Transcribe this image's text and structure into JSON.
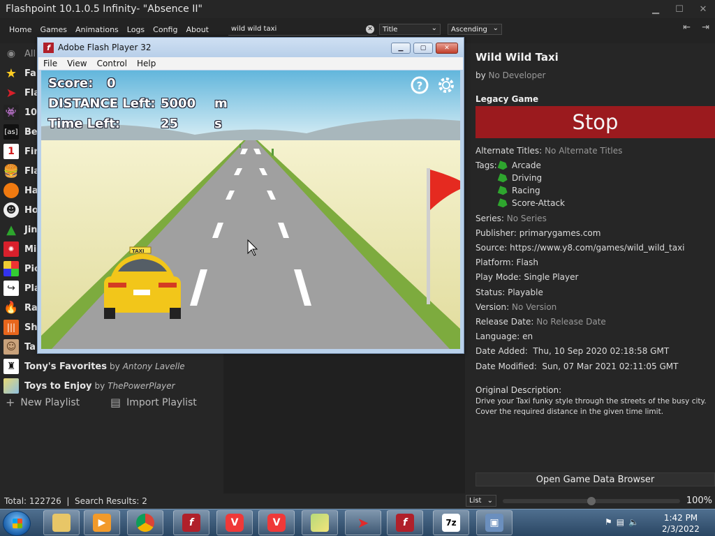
{
  "window": {
    "title": "Flashpoint 10.1.0.5 Infinity- \"Absence II\""
  },
  "menu": [
    "Home",
    "Games",
    "Animations",
    "Logs",
    "Config",
    "About"
  ],
  "search": {
    "value": "wild wild taxi"
  },
  "sort": {
    "field": "Title",
    "order": "Ascending"
  },
  "sidebar": {
    "items": [
      {
        "label": "All",
        "icon": "eye-icon"
      },
      {
        "label": "Fa",
        "icon": "star-icon"
      },
      {
        "label": "Fla",
        "icon": "flashpoint-icon"
      },
      {
        "label": "10",
        "icon": "space-invader-icon"
      },
      {
        "label": "Be",
        "icon": "as-icon"
      },
      {
        "label": "Fir",
        "icon": "number-one-icon"
      },
      {
        "label": "Fla",
        "icon": "burger-icon"
      },
      {
        "label": "Ha",
        "icon": "pumpkin-icon"
      },
      {
        "label": "Ho",
        "icon": "character-icon"
      },
      {
        "label": "Jin",
        "icon": "tree-icon"
      },
      {
        "label": "Mi",
        "icon": "game-logo-icon"
      },
      {
        "label": "Pic",
        "icon": "pixel-icon"
      },
      {
        "label": "Pla",
        "icon": "share-icon"
      },
      {
        "label": "Ra",
        "icon": "fire-icon"
      },
      {
        "label": "Sh",
        "icon": "soundwave-icon"
      },
      {
        "label": "Ta",
        "icon": "avatar-icon"
      }
    ],
    "named": [
      {
        "title": "Tony's Favorites",
        "by": "by",
        "author": "Antony Lavelle"
      },
      {
        "title": "Toys to Enjoy",
        "by": "by",
        "author": "ThePowerPlayer"
      }
    ],
    "new_playlist": "New Playlist",
    "import_playlist": "Import Playlist"
  },
  "flash": {
    "title": "Adobe Flash Player 32",
    "menu": [
      "File",
      "View",
      "Control",
      "Help"
    ],
    "hud": {
      "score_label": "Score:",
      "score_value": "0",
      "distance_label": "DISTANCE Left:",
      "distance_value": "5000",
      "distance_unit": "m",
      "time_label": "Time Left:",
      "time_value": "25",
      "time_unit": "s",
      "taxi_sign": "TAXI"
    }
  },
  "game": {
    "title": "Wild Wild Taxi",
    "by": "by",
    "developer": "No Developer",
    "legacy": "Legacy Game",
    "stop": "Stop",
    "alt_titles_label": "Alternate Titles:",
    "alt_titles": "No Alternate Titles",
    "tags_label": "Tags:",
    "tags": [
      "Arcade",
      "Driving",
      "Racing",
      "Score-Attack"
    ],
    "series_label": "Series:",
    "series": "No Series",
    "publisher_label": "Publisher:",
    "publisher": "primarygames.com",
    "source_label": "Source:",
    "source": "https://www.y8.com/games/wild_wild_taxi",
    "platform_label": "Platform:",
    "platform": "Flash",
    "playmode_label": "Play Mode:",
    "playmode": "Single Player",
    "status_label": "Status:",
    "status": "Playable",
    "version_label": "Version:",
    "version": "No Version",
    "release_label": "Release Date:",
    "release": "No Release Date",
    "language_label": "Language:",
    "language": "en",
    "added_label": "Date Added:",
    "added": "Thu, 10 Sep 2020 02:18:58 GMT",
    "modified_label": "Date Modified:",
    "modified": "Sun, 07 Mar 2021 02:11:05 GMT",
    "desc_label": "Original Description:",
    "desc_line1": "Drive your Taxi funky style through the streets of the busy city.",
    "desc_line2": "Cover the required distance in the given time limit.",
    "browse": "Open Game Data Browser"
  },
  "status": {
    "total_label": "Total:",
    "total": "122726",
    "results_label": "Search Results:",
    "results": "2",
    "view": "List",
    "zoom_level": 0.5,
    "zoom": "100%"
  },
  "taskbar": {
    "time": "1:42 PM",
    "date": "2/3/2022"
  },
  "colors": {
    "stop": "#9b1a1e",
    "tag": "#2ea52e",
    "background": "#232323"
  }
}
